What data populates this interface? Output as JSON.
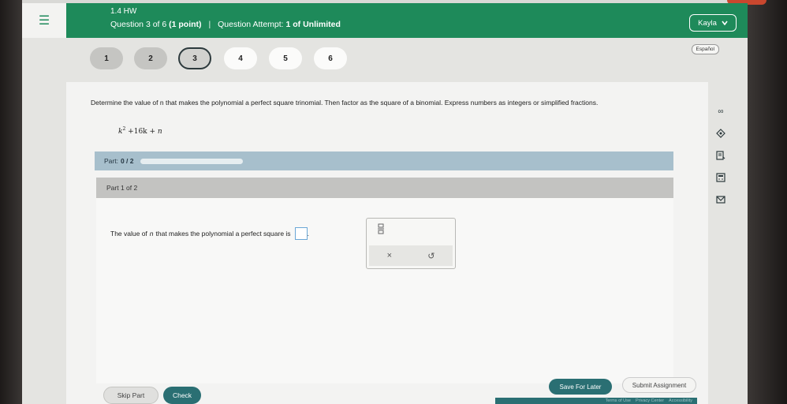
{
  "header": {
    "hw_title": "1.4 HW",
    "question_label": "Question 3 of 6",
    "points": "(1 point)",
    "attempt_label": "Question Attempt:",
    "attempt_value": "1 of Unlimited",
    "user_name": "Kayla"
  },
  "nav": {
    "questions": [
      {
        "label": "1",
        "status": "done"
      },
      {
        "label": "2",
        "status": "done"
      },
      {
        "label": "3",
        "status": "current"
      },
      {
        "label": "4",
        "status": "todo"
      },
      {
        "label": "5",
        "status": "todo"
      },
      {
        "label": "6",
        "status": "todo"
      }
    ],
    "language_label": "Español"
  },
  "question": {
    "text": "Determine the value of n that makes the polynomial a perfect square trinomial. Then factor as the square of a binomial. Express numbers as integers or simplified fractions.",
    "expression_base": "k",
    "expression_exp": "2",
    "expression_rest": "+16k +",
    "expression_var": "n"
  },
  "part_progress": {
    "label": "Part:",
    "value": "0 / 2",
    "fraction": 0
  },
  "part": {
    "label": "Part 1 of 2",
    "prompt_start": "The value of",
    "prompt_var": "n",
    "prompt_end": "that makes the polynomial a perfect square is",
    "prompt_period": ".",
    "answer_value": ""
  },
  "palette": {
    "fraction_icon": "fraction-icon",
    "clear_icon": "×",
    "undo_icon": "↺"
  },
  "actions": {
    "skip": "Skip Part",
    "check": "Check",
    "save": "Save For Later",
    "submit": "Submit Assignment"
  },
  "footer": [
    "Terms of Use",
    "Privacy Center",
    "Accessibility"
  ],
  "side_tools": [
    "infinity-icon",
    "compass-icon",
    "book-icon",
    "calculator-icon",
    "mail-icon"
  ],
  "colors": {
    "header_green": "#1e8a5a",
    "accent_teal": "#2a6f73",
    "part_bar": "#a7bfcc"
  }
}
